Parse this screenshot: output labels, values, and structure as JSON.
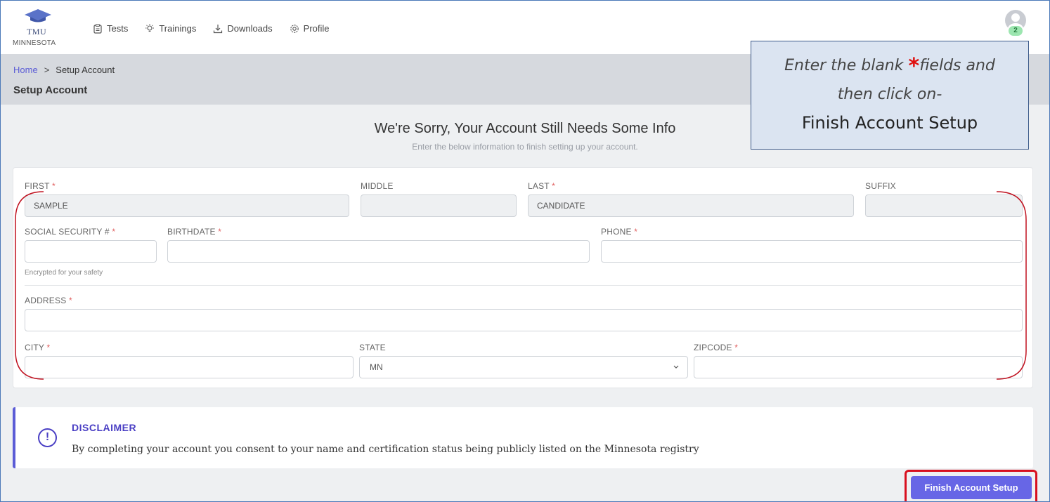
{
  "brand": {
    "logo_text": "TMU",
    "state": "MINNESOTA"
  },
  "nav": [
    {
      "label": "Tests",
      "icon": "clipboard-icon"
    },
    {
      "label": "Trainings",
      "icon": "lightbulb-icon"
    },
    {
      "label": "Downloads",
      "icon": "download-icon"
    },
    {
      "label": "Profile",
      "icon": "gear-icon"
    }
  ],
  "user": {
    "notification_count": "2"
  },
  "breadcrumb": {
    "home": "Home",
    "separator": ">",
    "current": "Setup Account"
  },
  "page_title": "Setup Account",
  "heading": {
    "title": "We're Sorry, Your Account Still Needs Some Info",
    "subtitle": "Enter the below information to finish setting up your account."
  },
  "form": {
    "required_marker": "*",
    "first": {
      "label": "FIRST",
      "value": "SAMPLE"
    },
    "middle": {
      "label": "MIDDLE",
      "value": ""
    },
    "last": {
      "label": "LAST",
      "value": "CANDIDATE"
    },
    "suffix": {
      "label": "SUFFIX",
      "value": ""
    },
    "ssn": {
      "label": "SOCIAL SECURITY #",
      "value": "",
      "hint": "Encrypted for your safety"
    },
    "birthdate": {
      "label": "BIRTHDATE",
      "value": ""
    },
    "phone": {
      "label": "PHONE",
      "value": ""
    },
    "address": {
      "label": "ADDRESS",
      "value": ""
    },
    "city": {
      "label": "CITY",
      "value": ""
    },
    "state": {
      "label": "STATE",
      "value": "MN"
    },
    "zipcode": {
      "label": "ZIPCODE",
      "value": ""
    }
  },
  "disclaimer": {
    "title": "DISCLAIMER",
    "text": "By completing your account you consent to your name and certification status being publicly listed on the Minnesota registry",
    "icon": "exclamation-circle-icon"
  },
  "finish_button": "Finish Account Setup",
  "callout": {
    "line1_pre": "Enter the blank ",
    "line1_star": "*",
    "line1_post": "fields and",
    "line2": "then click on-",
    "line3": "Finish Account Setup"
  },
  "colors": {
    "accent": "#6766e6",
    "required": "#e06060",
    "annotation_red": "#d8101f",
    "callout_bg": "#dbe4f1"
  }
}
